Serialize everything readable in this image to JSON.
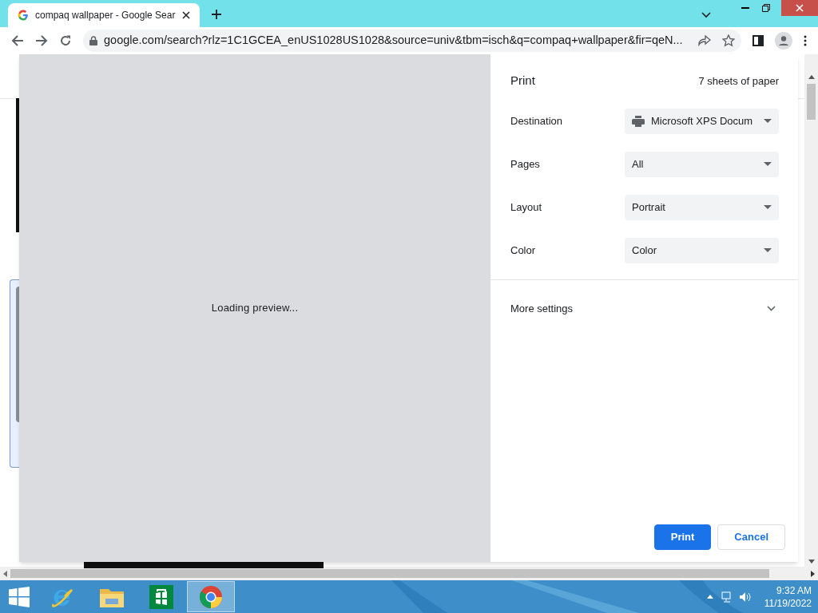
{
  "browser": {
    "tab": {
      "title": "compaq wallpaper - Google Sear",
      "selected": true
    },
    "address": "google.com/search?rlz=1C1GCEA_enUS1028US1028&source=univ&tbm=isch&q=compaq+wallpaper&fir=qeN..."
  },
  "preview": {
    "message": "Loading preview..."
  },
  "print": {
    "title": "Print",
    "summary": "7 sheets of paper",
    "settings": [
      {
        "label": "Destination",
        "value": "Microsoft XPS Docum",
        "kind": "printer"
      },
      {
        "label": "Pages",
        "value": "All",
        "kind": "select"
      },
      {
        "label": "Layout",
        "value": "Portrait",
        "kind": "select"
      },
      {
        "label": "Color",
        "value": "Color",
        "kind": "select"
      }
    ],
    "more_settings": {
      "label": "More settings",
      "expanded": false
    },
    "buttons": [
      {
        "label": "Print",
        "kind": "primary"
      },
      {
        "label": "Cancel",
        "kind": "secondary"
      }
    ]
  },
  "taskbar": {
    "apps": [
      {
        "kind": "ie",
        "selected": false
      },
      {
        "kind": "explorer",
        "selected": false
      },
      {
        "kind": "store",
        "selected": false
      },
      {
        "kind": "chrome",
        "selected": true
      }
    ],
    "time": "9:32 AM",
    "date": "11/19/2022"
  }
}
